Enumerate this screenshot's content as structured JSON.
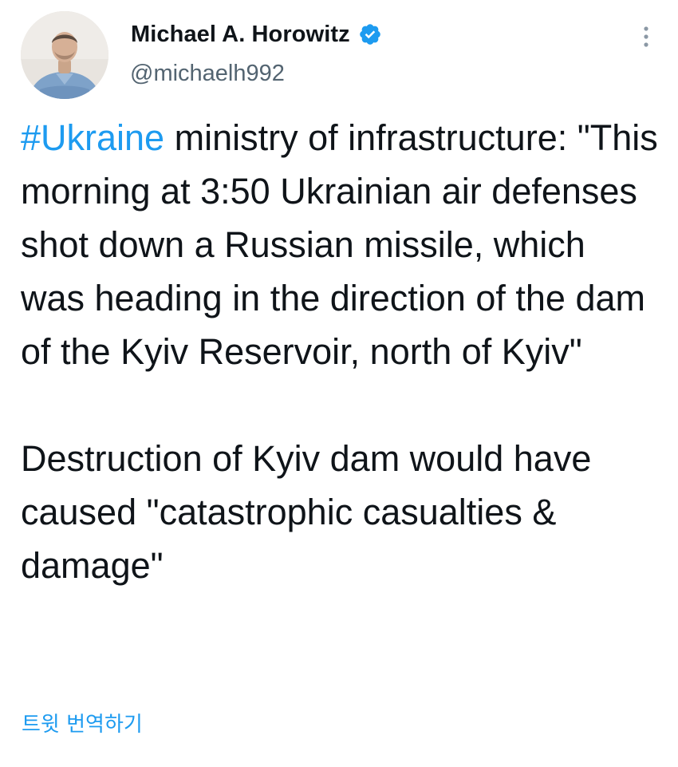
{
  "author": {
    "display_name": "Michael A. Horowitz",
    "handle": "@michaelh992",
    "verified": true,
    "avatar_icon": "profile-photo-man-blue-shirt"
  },
  "icons": {
    "verified": "verified-badge-icon",
    "more": "more-vertical-icon"
  },
  "tweet": {
    "hashtag": "#Ukraine",
    "paragraph1_rest": " ministry of infrastructure: \"This morning at 3:50 Ukrainian air defenses shot down a Russian missile, which was heading in the direction of the dam of the Kyiv Reservoir, north of Kyiv\"",
    "paragraph2": "Destruction of Kyiv dam would have caused \"catastrophic casualties & damage\""
  },
  "translate_label": "트윗 번역하기",
  "colors": {
    "link": "#1d9bf0",
    "text": "#0f1419",
    "secondary": "#536471",
    "background": "#ffffff"
  }
}
